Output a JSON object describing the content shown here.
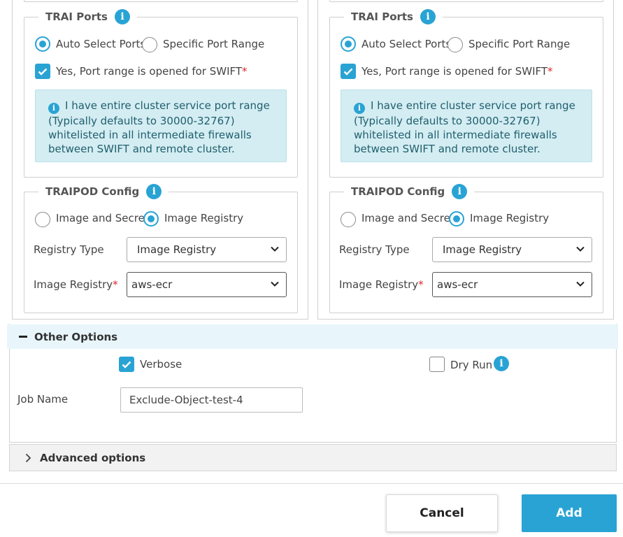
{
  "colors": {
    "accent": "#29a3d4",
    "alert_bg": "#d4edf2",
    "section_bg": "#e8f6fb",
    "required": "#e0242b"
  },
  "panels": [
    {
      "trai_ports": {
        "title": "TRAI Ports",
        "radio_auto": "Auto Select Ports",
        "radio_specific": "Specific Port Range",
        "checkbox_label": "Yes, Port range is opened for SWIFT",
        "required_mark": "*",
        "alert_text": "I have entire cluster service port range (Typically defaults to 30000-32767) whitelisted in all intermediate firewalls between SWIFT and remote cluster."
      },
      "traipod_config": {
        "title": "TRAIPOD Config",
        "radio_image_secret": "Image and Secret",
        "radio_image_registry": "Image Registry",
        "registry_type_label": "Registry Type",
        "registry_type_value": "Image Registry",
        "image_registry_label": "Image Registry",
        "required_mark": "*",
        "image_registry_value": "aws-ecr"
      }
    },
    {
      "trai_ports": {
        "title": "TRAI Ports",
        "radio_auto": "Auto Select Ports",
        "radio_specific": "Specific Port Range",
        "checkbox_label": "Yes, Port range is opened for SWIFT",
        "required_mark": "*",
        "alert_text": "I have entire cluster service port range (Typically defaults to 30000-32767) whitelisted in all intermediate firewalls between SWIFT and remote cluster."
      },
      "traipod_config": {
        "title": "TRAIPOD Config",
        "radio_image_secret": "Image and Secret",
        "radio_image_registry": "Image Registry",
        "registry_type_label": "Registry Type",
        "registry_type_value": "Image Registry",
        "image_registry_label": "Image Registry",
        "required_mark": "*",
        "image_registry_value": "aws-ecr"
      }
    }
  ],
  "other_options": {
    "title": "Other Options",
    "verbose_label": "Verbose",
    "verbose_checked": true,
    "dry_run_label": "Dry Run",
    "dry_run_checked": false,
    "job_name_label": "Job Name",
    "job_name_value": "Exclude-Object-test-4"
  },
  "advanced_options": {
    "title": "Advanced options"
  },
  "footer": {
    "cancel_label": "Cancel",
    "add_label": "Add"
  }
}
